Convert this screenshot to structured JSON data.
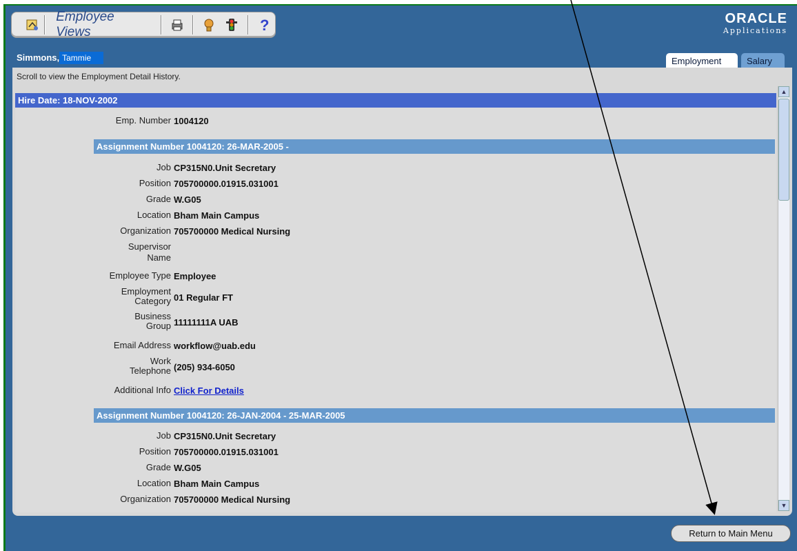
{
  "toolbar": {
    "title": "Employee Views",
    "icons": [
      "home-icon",
      "print-icon",
      "help-person-icon",
      "traffic-light-icon",
      "question-icon"
    ]
  },
  "logo": {
    "main": "ORACLE",
    "sub": "Applications"
  },
  "person": {
    "last": "Simmons,",
    "first": "Tammie"
  },
  "tabs": [
    {
      "label": "Employment",
      "active": true
    },
    {
      "label": "Salary",
      "active": false
    }
  ],
  "scroll_hint": "Scroll to view the Employment Detail History.",
  "hire_date": "Hire Date: 18-NOV-2002",
  "emp_number": {
    "label": "Emp. Number",
    "value": "1004120"
  },
  "assignment1": {
    "header": "Assignment Number 1004120: 26-MAR-2005 -",
    "job": {
      "label": "Job",
      "value": "CP315N0.Unit Secretary"
    },
    "position": {
      "label": "Position",
      "value": "705700000.01915.031001"
    },
    "grade": {
      "label": "Grade",
      "value": "W.G05"
    },
    "location": {
      "label": "Location",
      "value": "Bham Main Campus"
    },
    "organization": {
      "label": "Organization",
      "value": "705700000 Medical Nursing"
    },
    "supervisor_a": "Supervisor",
    "supervisor_b": "Name",
    "employee_type": {
      "label": "Employee Type",
      "value": "Employee"
    },
    "emp_cat_a": "Employment",
    "emp_cat_b": "Category",
    "emp_cat_value": "01 Regular FT",
    "bus_group_a": "Business",
    "bus_group_b": "Group",
    "bus_group_value": "11111111A UAB",
    "email": {
      "label": "Email Address",
      "value": "workflow@uab.edu"
    },
    "work_tel_a": "Work",
    "work_tel_b": "Telephone",
    "work_tel_value": "(205) 934-6050",
    "additional": {
      "label": "Additional Info",
      "value": "Click For Details"
    }
  },
  "assignment2": {
    "header": "Assignment Number 1004120: 26-JAN-2004 - 25-MAR-2005",
    "job": {
      "label": "Job",
      "value": "CP315N0.Unit Secretary"
    },
    "position": {
      "label": "Position",
      "value": "705700000.01915.031001"
    },
    "grade": {
      "label": "Grade",
      "value": "W.G05"
    },
    "location": {
      "label": "Location",
      "value": "Bham Main Campus"
    },
    "organization": {
      "label": "Organization",
      "value": "705700000 Medical Nursing"
    }
  },
  "return_button": "Return to Main Menu"
}
